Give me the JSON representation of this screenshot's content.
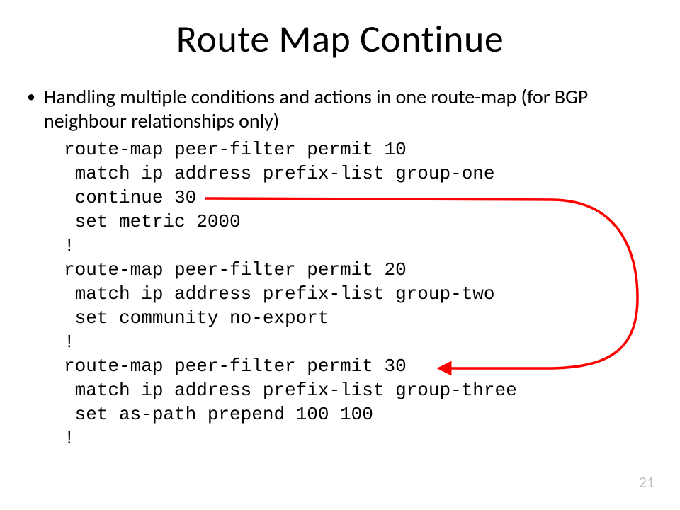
{
  "title": "Route Map Continue",
  "bullet": "Handling multiple conditions and actions in one route-map (for BGP neighbour relationships only)",
  "code_lines": [
    "route-map peer-filter permit 10",
    " match ip address prefix-list group-one",
    " continue 30",
    " set metric 2000",
    "!",
    "route-map peer-filter permit 20",
    " match ip address prefix-list group-two",
    " set community no-export",
    "!",
    "route-map peer-filter permit 30",
    " match ip address prefix-list group-three",
    " set as-path prepend 100 100",
    "!"
  ],
  "page_number": "21",
  "arrow": {
    "color": "#ff0000"
  }
}
